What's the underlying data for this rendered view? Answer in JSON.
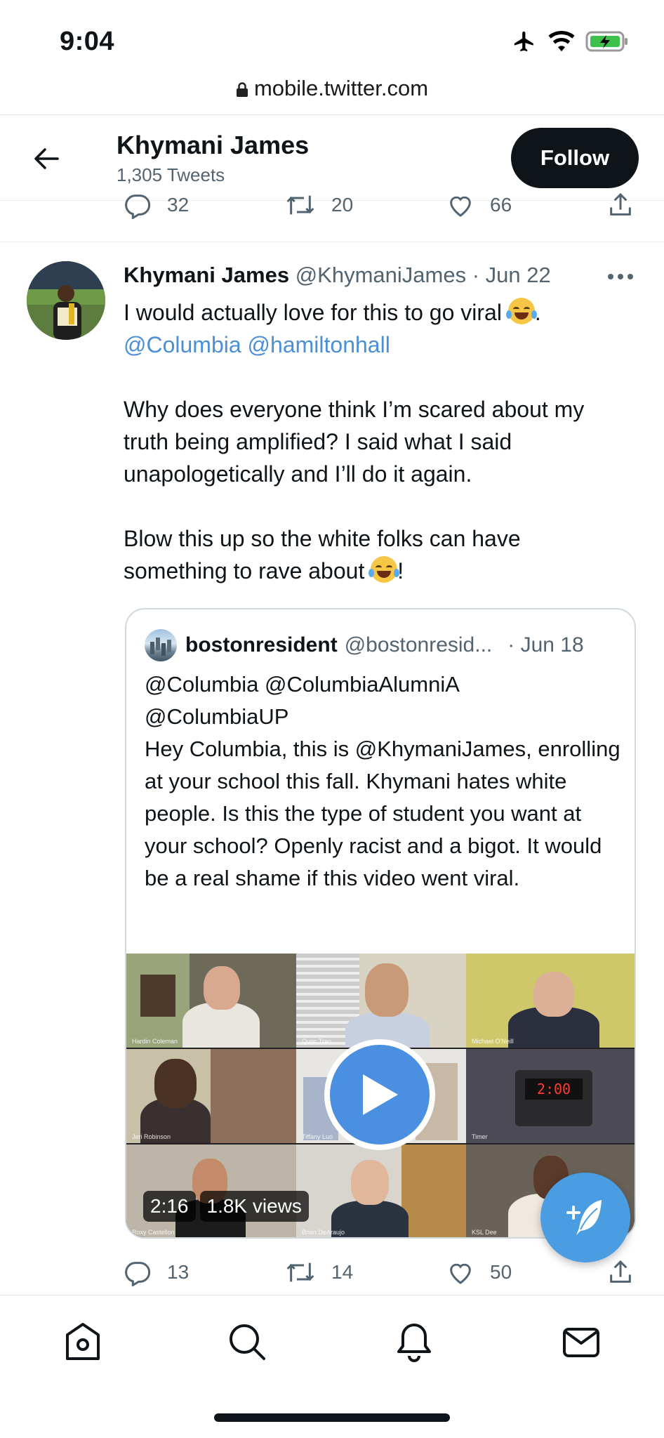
{
  "status_bar": {
    "time": "9:04"
  },
  "browser": {
    "url": "mobile.twitter.com"
  },
  "header": {
    "name": "Khymani James",
    "tweet_count": "1,305 Tweets",
    "follow_label": "Follow"
  },
  "prev_tweet_actions": {
    "replies": "32",
    "retweets": "20",
    "likes": "66"
  },
  "tweet": {
    "author_name": "Khymani James",
    "author_handle": "@KhymaniJames",
    "date": "· Jun 22",
    "line1": "I would actually love for this to go viral",
    "line1_end": ".",
    "mention_1": "@Columbia",
    "mention_2": "@hamiltonhall",
    "para2": "Why does everyone think I’m scared about my truth being amplified? I said what I said unapologetically and I’ll do it again.",
    "para3_a": "Blow this up so the white folks can have something to rave about",
    "para3_end": "!",
    "actions": {
      "replies": "13",
      "retweets": "14",
      "likes": "50"
    }
  },
  "quoted": {
    "author_name": "bostonresident",
    "author_handle": "@bostonresid...",
    "date": "· Jun 18",
    "mentions_line1": "@Columbia @ColumbiaAlumniA",
    "mentions_line2": "@ColumbiaUP",
    "body": "Hey Columbia, this is @KhymaniJames, enrolling at your school this fall. Khymani hates white people. Is this the type of student you want at your school? Openly racist and a bigot. It would be a real shame if this video went viral.",
    "video": {
      "duration": "2:16",
      "views": "1.8K views",
      "timer_display": "2:00",
      "participants": [
        "Hardin Coleman",
        "Quoc Tran",
        "Michael O'Neill",
        "Jeri Robinson",
        "Tiffany Luo",
        "Timer",
        "Roxy Castellon",
        "Brian DeAraujo",
        "KSL Dee"
      ]
    }
  },
  "icons": [
    "back-arrow-icon",
    "reply-icon",
    "retweet-icon",
    "like-icon",
    "share-icon",
    "more-icon",
    "play-icon",
    "compose-icon",
    "home-icon",
    "search-icon",
    "notifications-icon",
    "messages-icon"
  ],
  "colors": {
    "link": "#4a8fd8",
    "follow_bg": "#0f1419",
    "fab": "#4a9de0",
    "secondary_text": "#536471"
  }
}
